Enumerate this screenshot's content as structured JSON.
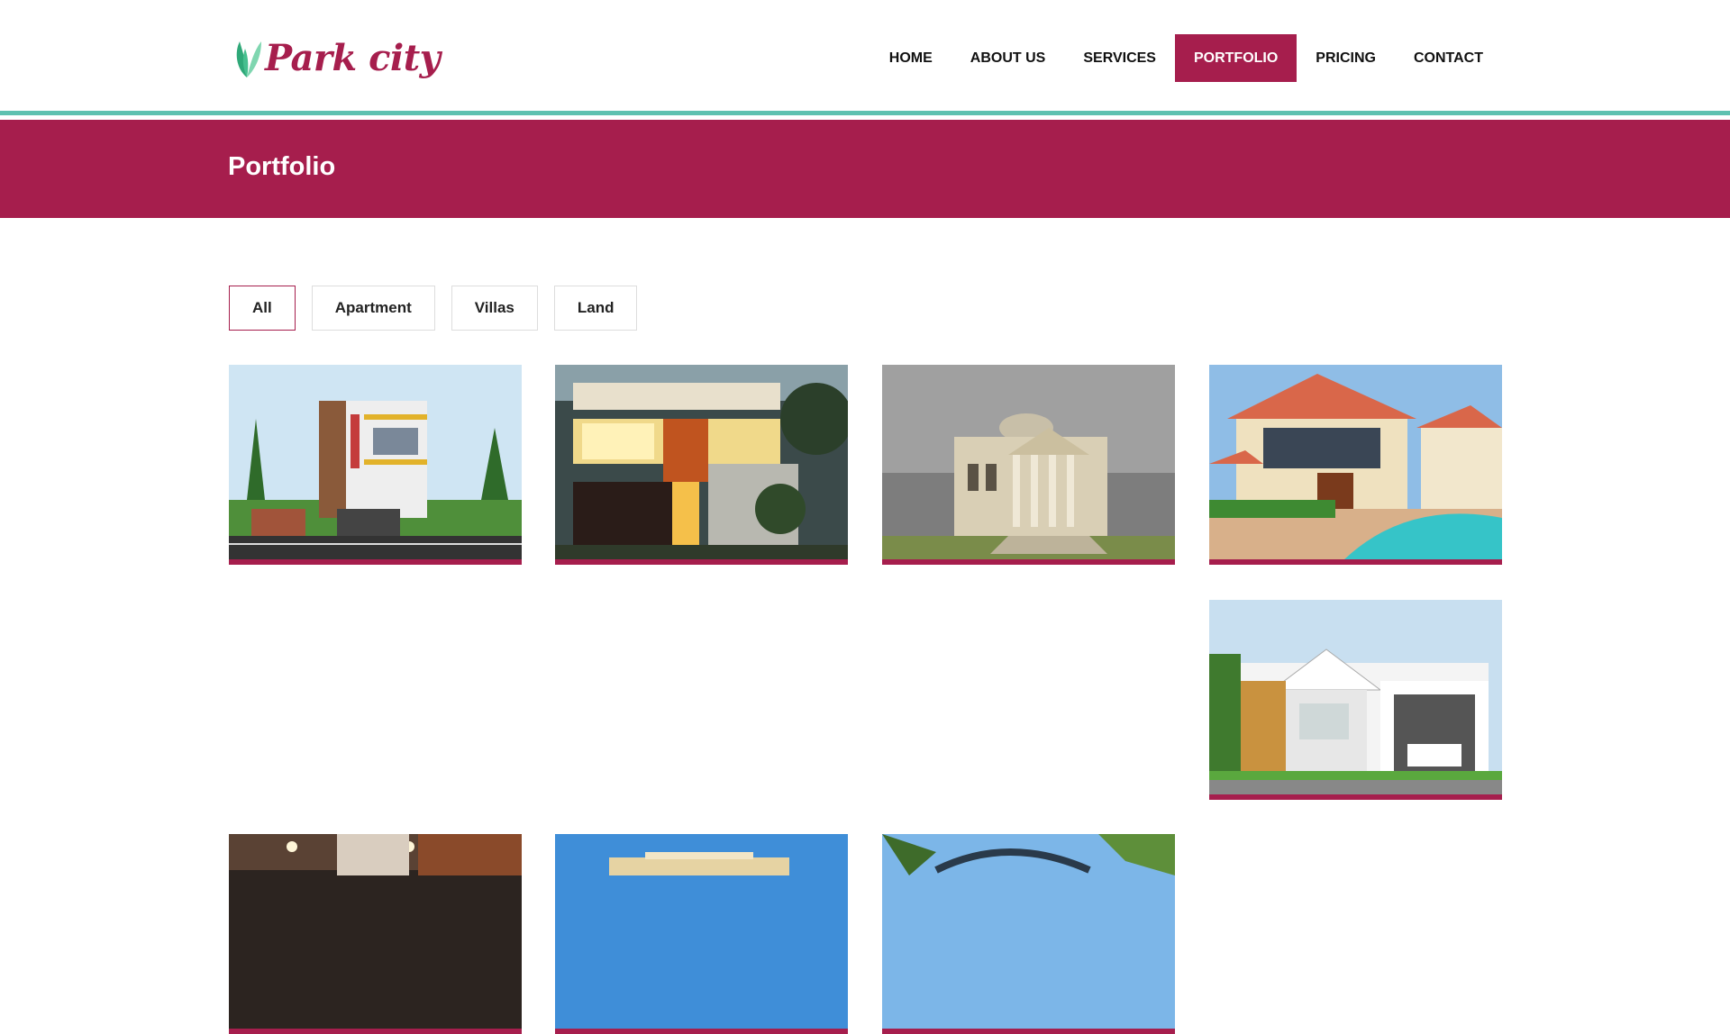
{
  "brand": {
    "name": "Park city",
    "color": "#a61e4d",
    "accent": "#5fc1b0",
    "leaf_colors": [
      "#2fa878",
      "#7fd6b0"
    ]
  },
  "nav": {
    "items": [
      {
        "label": "HOME"
      },
      {
        "label": "ABOUT US"
      },
      {
        "label": "SERVICES"
      },
      {
        "label": "PORTFOLIO",
        "active": true
      },
      {
        "label": "PRICING"
      },
      {
        "label": "CONTACT"
      }
    ]
  },
  "page": {
    "title": "Portfolio"
  },
  "filters": [
    {
      "label": "All",
      "active": true
    },
    {
      "label": "Apartment"
    },
    {
      "label": "Villas"
    },
    {
      "label": "Land"
    }
  ],
  "gallery": {
    "items": [
      {
        "kind": "modern-villa-street"
      },
      {
        "kind": "modern-house-night"
      },
      {
        "kind": "classical-villa"
      },
      {
        "kind": "villa-pool"
      },
      {
        "kind": "single-storey-house"
      },
      {
        "kind": "interior-lights"
      },
      {
        "kind": "modern-house-blue-sky"
      },
      {
        "kind": "house-palm-trees"
      }
    ]
  }
}
